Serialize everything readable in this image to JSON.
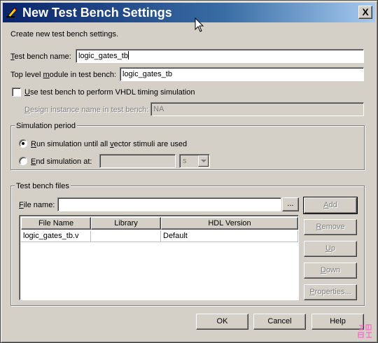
{
  "window": {
    "title": "New Test Bench Settings",
    "close_label": "X"
  },
  "intro": "Create new test bench settings.",
  "fields": {
    "test_bench_name": {
      "label_pre": "",
      "label_key": "T",
      "label_post": "est bench name:",
      "value": "logic_gates_tb"
    },
    "top_level_module": {
      "label_pre": "Top level ",
      "label_key": "m",
      "label_post": "odule in test bench:",
      "value": "logic_gates_tb"
    },
    "vhdl_timing": {
      "label_pre": "",
      "label_key": "U",
      "label_post": "se test bench to perform VHDL timing simulation",
      "checked": false
    },
    "design_instance": {
      "label_pre": "",
      "label_key": "D",
      "label_post": "esign instance name in test bench:",
      "value": "NA"
    }
  },
  "simulation_period": {
    "title": "Simulation period",
    "run_all": {
      "label_pre": "",
      "label_key": "R",
      "label_post": "un simulation until all ",
      "label_key2": "v",
      "label_post2": "ector stimuli are used",
      "selected": true
    },
    "end_at": {
      "label_pre": "",
      "label_key": "E",
      "label_post": "nd simulation at:",
      "selected": false,
      "value": "",
      "unit": "s"
    }
  },
  "test_bench_files": {
    "title": "Test bench files",
    "file_name_label_pre": "",
    "file_name_label_key": "F",
    "file_name_label_post": "ile name:",
    "file_name_value": "",
    "browse_label": "...",
    "columns": [
      "File Name",
      "Library",
      "HDL Version"
    ],
    "rows": [
      {
        "file_name": "logic_gates_tb.v",
        "library": "",
        "hdl_version": "Default"
      }
    ],
    "buttons": {
      "add": {
        "pre": "",
        "key": "A",
        "post": "dd"
      },
      "remove": {
        "pre": "",
        "key": "R",
        "post": "emove"
      },
      "up": {
        "pre": "",
        "key": "U",
        "post": "p"
      },
      "down": {
        "pre": "",
        "key": "D",
        "post": "own"
      },
      "properties": {
        "pre": "",
        "key": "P",
        "post": "roperties..."
      }
    }
  },
  "footer": {
    "ok": "OK",
    "cancel": "Cancel",
    "help": "Help"
  },
  "colors": {
    "titlebar_start": "#0a246a",
    "titlebar_end": "#a6caf0",
    "dialog_bg": "#d4d0c8",
    "watermark": "#ff66cc"
  },
  "icons": {
    "title": "pencil-icon",
    "cursor": "mouse-cursor-icon"
  }
}
